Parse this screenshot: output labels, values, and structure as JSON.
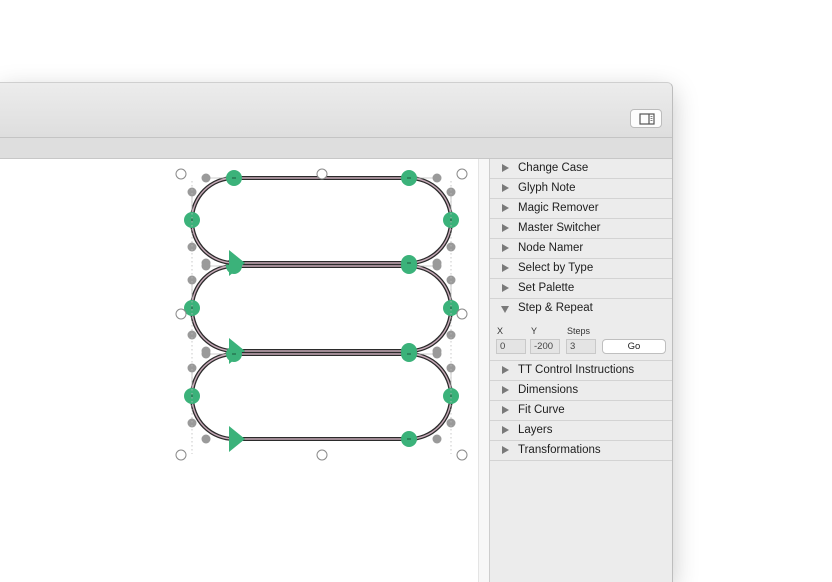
{
  "toolbar": {
    "sidebar_toggle_icon": "sidebar-right-icon"
  },
  "panel": {
    "items_before": [
      {
        "label": "Change Case"
      },
      {
        "label": "Glyph Note"
      },
      {
        "label": "Magic Remover"
      },
      {
        "label": "Master Switcher"
      },
      {
        "label": "Node Namer"
      },
      {
        "label": "Select by Type"
      },
      {
        "label": "Set Palette"
      }
    ],
    "step_repeat": {
      "label": "Step & Repeat",
      "x_label": "X",
      "y_label": "Y",
      "steps_label": "Steps",
      "x_value": "0",
      "y_value": "-200",
      "steps_value": "3",
      "go_label": "Go"
    },
    "items_after": [
      {
        "label": "TT Control Instructions"
      },
      {
        "label": "Dimensions"
      },
      {
        "label": "Fit Curve"
      },
      {
        "label": "Layers"
      },
      {
        "label": "Transformations"
      }
    ]
  },
  "colors": {
    "node_on_curve": "#3bb27a",
    "node_off_curve": "#9a9a9a",
    "outline": "#2b2b2b",
    "outline_inner": "#c7aab8"
  }
}
